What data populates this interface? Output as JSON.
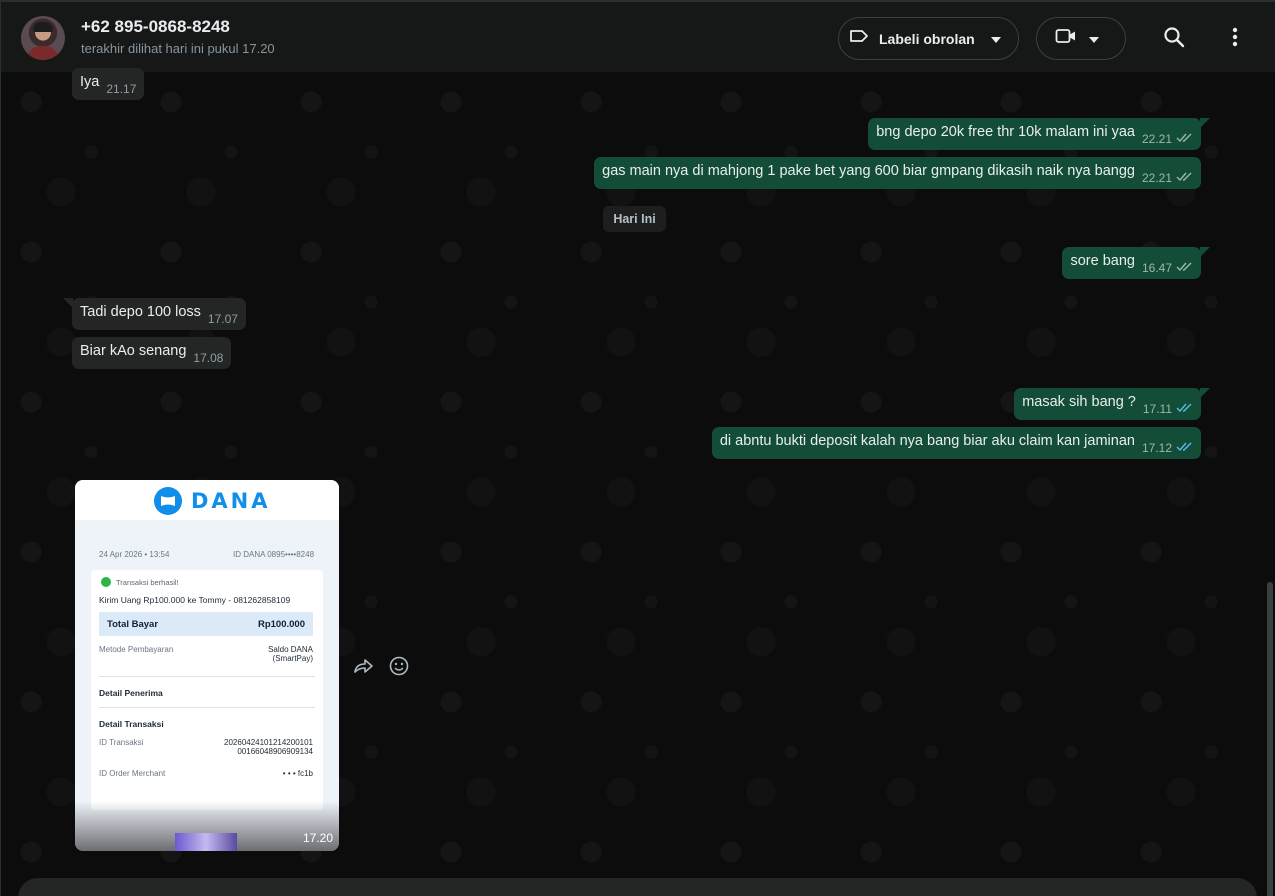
{
  "header": {
    "contact_name": "+62 895-0868-8248",
    "last_seen": "terakhir dilihat hari ini pukul 17.20",
    "label_button": "Labeli obrolan",
    "icons": [
      "tag-icon",
      "chevron-down-icon",
      "video-call-icon",
      "search-icon",
      "more-vert-icon"
    ]
  },
  "day_divider": "Hari Ini",
  "messages": [
    {
      "dir": "in",
      "text": "Iya",
      "time": "21.17"
    },
    {
      "dir": "out",
      "text": "bng depo 20k free thr 10k malam ini yaa",
      "time": "22.21",
      "status": "read-grey"
    },
    {
      "dir": "out",
      "text": "gas main nya di mahjong 1 pake bet yang 600 biar gmpang dikasih naik nya bangg",
      "time": "22.21",
      "status": "read-grey"
    },
    {
      "dir": "out",
      "text": "sore bang",
      "time": "16.47",
      "status": "read-grey"
    },
    {
      "dir": "in",
      "text": "Tadi depo 100 loss",
      "time": "17.07"
    },
    {
      "dir": "in",
      "text": "Biar kAo senang",
      "time": "17.08"
    },
    {
      "dir": "out",
      "text": "masak sih bang ?",
      "time": "17.11",
      "status": "read-blue"
    },
    {
      "dir": "out",
      "text": "di abntu bukti deposit kalah nya bang biar aku claim kan jaminan",
      "time": "17.12",
      "status": "read-blue"
    }
  ],
  "image_message": {
    "time": "17.20",
    "receipt": {
      "brand": "DANA",
      "date": "24 Apr 2026 • 13:54",
      "account_id": "ID DANA 0895••••8248",
      "status": "Transaksi berhasil!",
      "title": "Kirim Uang Rp100.000 ke Tommy - 081262858109",
      "total_label": "Total Bayar",
      "total_value": "Rp100.000",
      "method_label": "Metode Pembayaran",
      "method_value_1": "Saldo DANA",
      "method_value_2": "(SmartPay)",
      "recipient_section": "Detail Penerima",
      "transaction_section": "Detail Transaksi",
      "trx_id_label": "ID Transaksi",
      "trx_id_value_1": "20260424101214200101",
      "trx_id_value_2": "00166048906909134",
      "order_label": "ID Order Merchant",
      "order_value": "• • • fc1b"
    }
  },
  "colors": {
    "outgoing_bubble": "#144d37",
    "incoming_bubble": "#242626",
    "read_tick_blue": "#53bdeb",
    "background": "#0c0c0c"
  }
}
